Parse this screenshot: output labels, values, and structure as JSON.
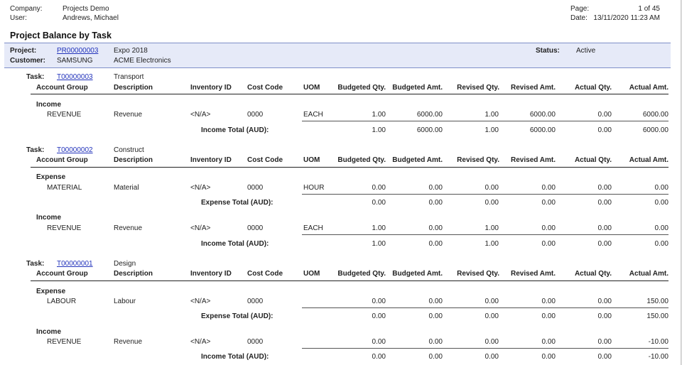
{
  "header": {
    "company_label": "Company:",
    "company": "Projects Demo",
    "user_label": "User:",
    "user": "Andrews, Michael",
    "page_label": "Page:",
    "page": "1 of 45",
    "date_label": "Date:",
    "date": "13/11/2020 11:23 AM"
  },
  "report_title": "Project Balance by Task",
  "project": {
    "project_label": "Project:",
    "project_id": "PR00000003",
    "project_desc": "Expo 2018",
    "customer_label": "Customer:",
    "customer_id": "SAMSUNG",
    "customer_name": "ACME Electronics",
    "status_label": "Status:",
    "status": "Active"
  },
  "columns": {
    "task_label": "Task:",
    "account_group": "Account Group",
    "description": "Description",
    "inventory_id": "Inventory ID",
    "cost_code": "Cost Code",
    "uom": "UOM",
    "budgeted_qty": "Budgeted Qty.",
    "budgeted_amt": "Budgeted Amt.",
    "revised_qty": "Revised Qty.",
    "revised_amt": "Revised Amt.",
    "actual_qty": "Actual Qty.",
    "actual_amt": "Actual Amt."
  },
  "tasks": [
    {
      "task_id": "T00000003",
      "task_desc": "Transport",
      "groups": [
        {
          "type": "Income",
          "row": {
            "account": "REVENUE",
            "desc": "Revenue",
            "inv": "<N/A>",
            "cost": "0000",
            "uom": "EACH",
            "bq": "1.00",
            "ba": "6000.00",
            "rq": "1.00",
            "ra": "6000.00",
            "aq": "0.00",
            "aa": "6000.00"
          },
          "total": {
            "label": "Income Total (AUD):",
            "bq": "1.00",
            "ba": "6000.00",
            "rq": "1.00",
            "ra": "6000.00",
            "aq": "0.00",
            "aa": "6000.00"
          }
        }
      ]
    },
    {
      "task_id": "T00000002",
      "task_desc": "Construct",
      "groups": [
        {
          "type": "Expense",
          "row": {
            "account": "MATERIAL",
            "desc": "Material",
            "inv": "<N/A>",
            "cost": "0000",
            "uom": "HOUR",
            "bq": "0.00",
            "ba": "0.00",
            "rq": "0.00",
            "ra": "0.00",
            "aq": "0.00",
            "aa": "0.00"
          },
          "total": {
            "label": "Expense Total (AUD):",
            "bq": "0.00",
            "ba": "0.00",
            "rq": "0.00",
            "ra": "0.00",
            "aq": "0.00",
            "aa": "0.00"
          }
        },
        {
          "type": "Income",
          "row": {
            "account": "REVENUE",
            "desc": "Revenue",
            "inv": "<N/A>",
            "cost": "0000",
            "uom": "EACH",
            "bq": "1.00",
            "ba": "0.00",
            "rq": "1.00",
            "ra": "0.00",
            "aq": "0.00",
            "aa": "0.00"
          },
          "total": {
            "label": "Income Total (AUD):",
            "bq": "1.00",
            "ba": "0.00",
            "rq": "1.00",
            "ra": "0.00",
            "aq": "0.00",
            "aa": "0.00"
          }
        }
      ]
    },
    {
      "task_id": "T00000001",
      "task_desc": "Design",
      "groups": [
        {
          "type": "Expense",
          "row": {
            "account": "LABOUR",
            "desc": "Labour",
            "inv": "<N/A>",
            "cost": "0000",
            "uom": "",
            "bq": "0.00",
            "ba": "0.00",
            "rq": "0.00",
            "ra": "0.00",
            "aq": "0.00",
            "aa": "150.00"
          },
          "total": {
            "label": "Expense Total (AUD):",
            "bq": "0.00",
            "ba": "0.00",
            "rq": "0.00",
            "ra": "0.00",
            "aq": "0.00",
            "aa": "150.00"
          }
        },
        {
          "type": "Income",
          "row": {
            "account": "REVENUE",
            "desc": "Revenue",
            "inv": "<N/A>",
            "cost": "0000",
            "uom": "",
            "bq": "0.00",
            "ba": "0.00",
            "rq": "0.00",
            "ra": "0.00",
            "aq": "0.00",
            "aa": "-10.00"
          },
          "total": {
            "label": "Income Total (AUD):",
            "bq": "0.00",
            "ba": "0.00",
            "rq": "0.00",
            "ra": "0.00",
            "aq": "0.00",
            "aa": "-10.00"
          }
        }
      ]
    }
  ]
}
